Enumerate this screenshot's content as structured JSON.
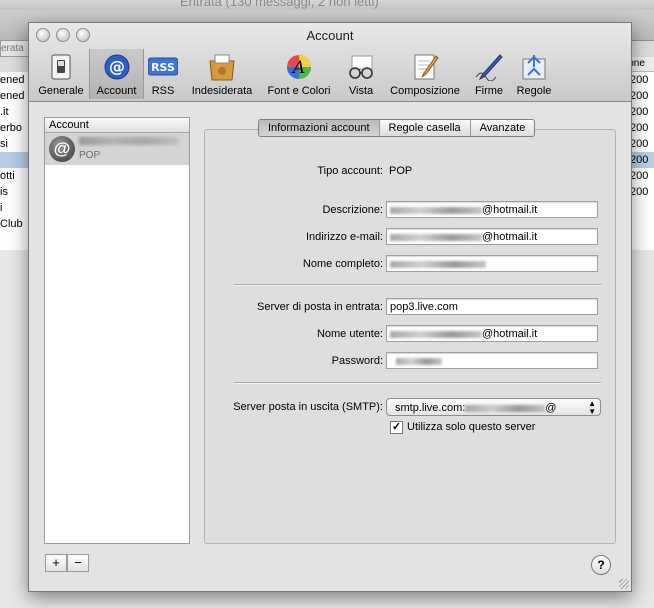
{
  "background_window": {
    "title": "Entrata (130 messaggi, 2 non letti)",
    "tab_partial": "erata",
    "column_header_partial": "ione",
    "left_list": [
      "ened",
      "ened",
      ".it",
      "erbo",
      "si",
      "",
      "otti",
      "is",
      "i",
      " Club"
    ],
    "right_list": [
      "200",
      "200",
      "200",
      "200",
      "200",
      "200",
      "200",
      "200"
    ]
  },
  "window": {
    "title": "Account"
  },
  "toolbar": {
    "items": [
      {
        "label": "Generale",
        "icon": "switch-icon"
      },
      {
        "label": "Account",
        "icon": "at-sign-icon"
      },
      {
        "label": "RSS",
        "icon": "rss-icon"
      },
      {
        "label": "Indesiderata",
        "icon": "junk-mail-icon"
      },
      {
        "label": "Font e Colori",
        "icon": "font-colors-icon"
      },
      {
        "label": "Vista",
        "icon": "glasses-icon"
      },
      {
        "label": "Composizione",
        "icon": "compose-icon"
      },
      {
        "label": "Firme",
        "icon": "signature-pen-icon"
      },
      {
        "label": "Regole",
        "icon": "rules-icon"
      }
    ],
    "selected": "Account"
  },
  "sidebar": {
    "header": "Account",
    "account_type": "POP",
    "add_label": "+",
    "remove_label": "−"
  },
  "tabs": [
    "Informazioni account",
    "Regole casella",
    "Avanzate"
  ],
  "form": {
    "tipo_label": "Tipo account:",
    "tipo_value": "POP",
    "descrizione_label": "Descrizione:",
    "descrizione_suffix": "@hotmail.it",
    "email_label": "Indirizzo e-mail:",
    "email_suffix": "@hotmail.it",
    "nome_label": "Nome completo:",
    "server_in_label": "Server di posta in entrata:",
    "server_in_value": "pop3.live.com",
    "utente_label": "Nome utente:",
    "utente_suffix": "@hotmail.it",
    "password_label": "Password:",
    "smtp_label": "Server posta in uscita (SMTP):",
    "smtp_value": "smtp.live.com:",
    "smtp_suffix": "@",
    "checkbox_label": "Utilizza solo questo server",
    "checkbox_mark": "✓"
  },
  "help_label": "?"
}
